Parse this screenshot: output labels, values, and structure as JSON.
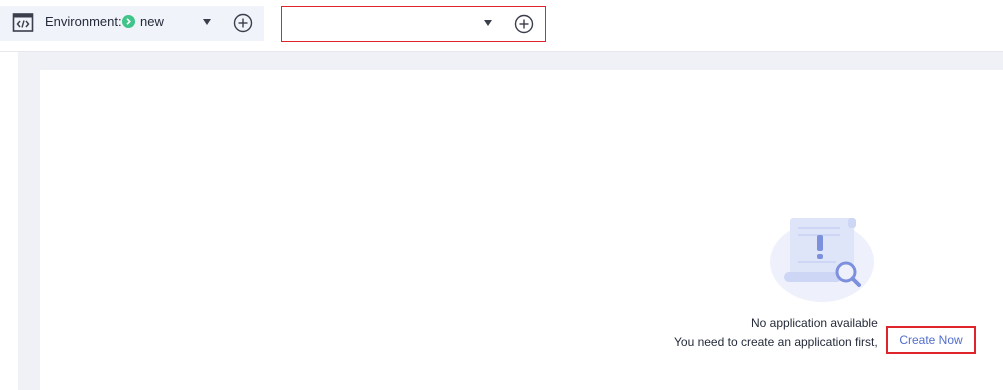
{
  "toolbar": {
    "environment_label": "Environment:",
    "environment_value": "new",
    "environment_status_color": "#3fc58a",
    "app_select_value": ""
  },
  "empty_state": {
    "title": "No application available",
    "description": "You need to create an application first,",
    "create_link": "Create Now"
  },
  "colors": {
    "accent_link": "#526ecc",
    "highlight_border": "#e0242b"
  }
}
